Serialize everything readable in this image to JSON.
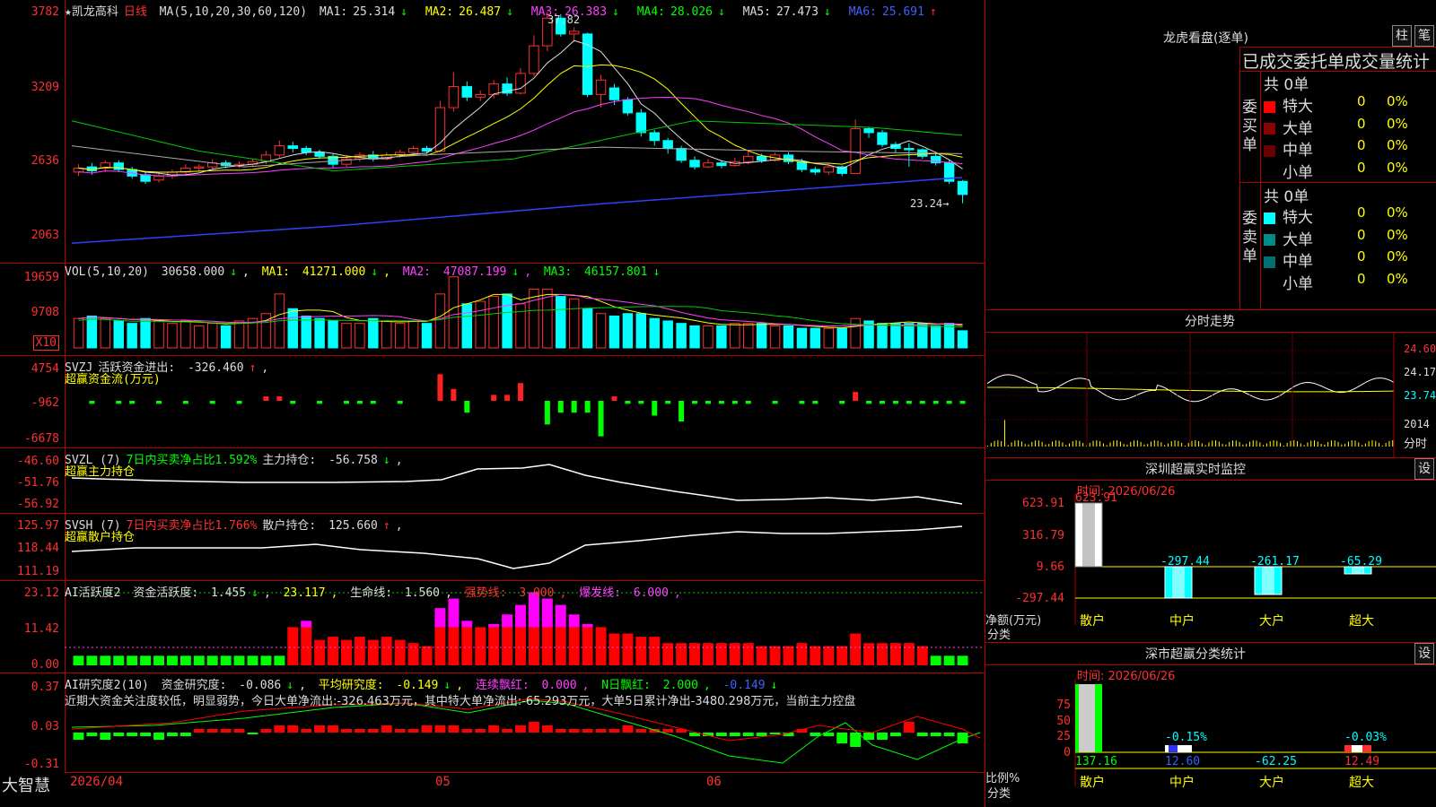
{
  "stock": {
    "name": "★凯龙高科",
    "period": "日线",
    "ma_label": "MA(5,10,20,30,60,120)",
    "ma": [
      {
        "label": "MA1:",
        "value": "25.314",
        "dir": "down"
      },
      {
        "label": "MA2:",
        "value": "26.487",
        "dir": "down"
      },
      {
        "label": "MA3:",
        "value": "26.383",
        "dir": "down"
      },
      {
        "label": "MA4:",
        "value": "28.026",
        "dir": "down"
      },
      {
        "label": "MA5:",
        "value": "27.473",
        "dir": "down"
      },
      {
        "label": "MA6:",
        "value": "25.691",
        "dir": "up"
      }
    ],
    "y_labels": [
      "3782",
      "3209",
      "2636",
      "2063"
    ],
    "high_label": "37.82",
    "low_label": "23.24→"
  },
  "vol": {
    "label": "VOL(5,10,20)",
    "value": "30658.000",
    "ma": [
      {
        "label": "MA1:",
        "value": "41271.000",
        "dir": "down"
      },
      {
        "label": "MA2:",
        "value": "47087.199",
        "dir": "down"
      },
      {
        "label": "MA3:",
        "value": "46157.801",
        "dir": "down"
      }
    ],
    "y_labels": [
      "19659",
      "9708"
    ],
    "unit": "X10"
  },
  "svzj": {
    "label": "SVZJ",
    "field": "活跃资金进出:",
    "value": "-326.460",
    "sub": "超赢资金流(万元)",
    "y_labels": [
      "4754",
      "-962",
      "-6678"
    ]
  },
  "svzl": {
    "label": "SVZL (7)",
    "field1": "7日内买卖净占比1.592%",
    "field2": "主力持仓:",
    "value": "-56.758",
    "sub": "超赢主力持仓",
    "y_labels": [
      "-46.60",
      "-51.76",
      "-56.92"
    ]
  },
  "svsh": {
    "label": "SVSH (7)",
    "field1": "7日内买卖净占比1.766%",
    "field2": "散户持仓:",
    "value": "125.660",
    "sub": "超赢散户持仓",
    "y_labels": [
      "125.97",
      "118.44",
      "111.19"
    ]
  },
  "ai1": {
    "label": "AI活跃度2",
    "f1": "资金活跃度:",
    "v1": "1.455",
    "v2": "23.117",
    "f3": "生命线:",
    "v3": "1.560",
    "f4": "强势线:",
    "v4": "3.000",
    "f5": "爆发线:",
    "v5": "6.000",
    "y_labels": [
      "23.12",
      "11.42",
      "0.00"
    ]
  },
  "ai2": {
    "label": "AI研究度2(10)",
    "f1": "资金研究度:",
    "v1": "-0.086",
    "f2": "平均研究度:",
    "v2": "-0.149",
    "f3": "连续飘红:",
    "v3": "0.000",
    "f4": "N日飘红:",
    "v4": "2.000",
    "v5": "-0.149",
    "desc": "近期大资金关注度较低，明显弱势，今日大单净流出:-326.463万元，其中特大单净流出:-65.293万元，大单5日累计净出-3480.298万元，当前主力控盘",
    "y_labels": [
      "0.37",
      "0.03",
      "-0.31"
    ]
  },
  "bottom": {
    "brand": "大智慧",
    "dates": [
      "2026/04",
      "05",
      "06"
    ]
  },
  "lhb": {
    "title": "龙虎看盘(逐单)",
    "btn1": "柱",
    "btn2": "笔",
    "header": "已成交委托单成交量统计",
    "buy_label": "委买单",
    "sell_label": "委卖单",
    "buy_total": "共 0单",
    "sell_total": "共 0单",
    "buy_rows": [
      {
        "name": "特大",
        "count": "0",
        "pct": "0%",
        "color": "#ff0000"
      },
      {
        "name": "大单",
        "count": "0",
        "pct": "0%",
        "color": "#8b0000"
      },
      {
        "name": "中单",
        "count": "0",
        "pct": "0%",
        "color": "#6a0000"
      },
      {
        "name": "小单",
        "count": "0",
        "pct": "0%",
        "color": "#000000"
      }
    ],
    "sell_rows": [
      {
        "name": "特大",
        "count": "0",
        "pct": "0%",
        "color": "#00ffff"
      },
      {
        "name": "大单",
        "count": "0",
        "pct": "0%",
        "color": "#008b8b"
      },
      {
        "name": "中单",
        "count": "0",
        "pct": "0%",
        "color": "#007070"
      },
      {
        "name": "小单",
        "count": "0",
        "pct": "0%",
        "color": "#000000"
      }
    ]
  },
  "intraday": {
    "title": "分时走势",
    "y_labels": [
      "24.60",
      "24.17",
      "23.74"
    ],
    "vol_label": "2014",
    "vol_unit": "分时"
  },
  "sz_monitor": {
    "title": "深圳超赢实时监控",
    "btn": "设",
    "time": "时间: 2026/06/26",
    "y_labels": [
      "623.91",
      "316.79",
      "9.66",
      "-297.44"
    ],
    "ylab": "净额(万元)",
    "xlab": "分类",
    "bars": [
      {
        "name": "散户",
        "value": "623.91"
      },
      {
        "name": "中户",
        "value": "-297.44"
      },
      {
        "name": "大户",
        "value": "-261.17"
      },
      {
        "name": "超大",
        "value": "-65.29"
      }
    ]
  },
  "sz_class": {
    "title": "深市超赢分类统计",
    "btn": "设",
    "time": "时间: 2026/06/26",
    "y_labels": [
      "75",
      "50",
      "25",
      "0"
    ],
    "ylab": "比例%",
    "xlab": "分类",
    "bars": [
      {
        "name": "散户",
        "value": "137.16",
        "pct": ""
      },
      {
        "name": "中户",
        "value": "12.60",
        "pct": "-0.15%"
      },
      {
        "name": "大户",
        "value": "-62.25",
        "pct": ""
      },
      {
        "name": "超大",
        "value": "12.49",
        "pct": "-0.03%"
      }
    ]
  }
}
